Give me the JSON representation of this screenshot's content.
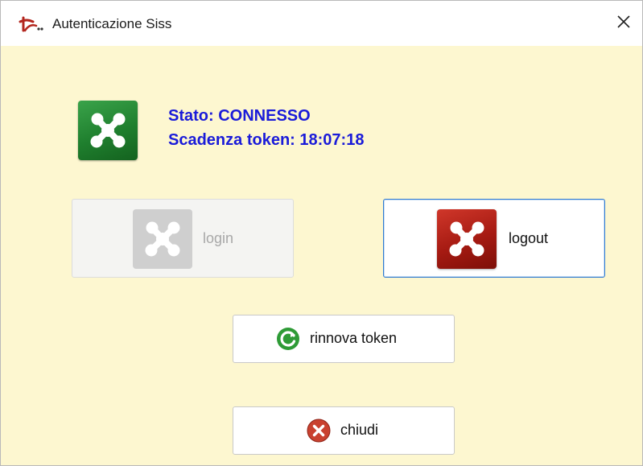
{
  "window": {
    "title": "Autenticazione Siss",
    "app_icon": "siss-logo-icon",
    "close_icon": "close-icon"
  },
  "status": {
    "icon": "network-connected-icon",
    "icon_color": "#2a8f3a",
    "state_line": "Stato: CONNESSO",
    "expiry_line": "Scadenza token: 18:07:18",
    "text_color": "#1a1bd9"
  },
  "buttons": {
    "login": {
      "label": "login",
      "enabled": false,
      "icon": "network-icon-disabled"
    },
    "logout": {
      "label": "logout",
      "enabled": true,
      "icon": "network-disconnect-icon",
      "icon_color": "#b02419"
    },
    "renew": {
      "label": "rinnova token",
      "icon": "refresh-icon",
      "icon_color": "#2e9b36"
    },
    "close": {
      "label": "chiudi",
      "icon": "close-circle-icon",
      "icon_color": "#c9412f"
    }
  },
  "colors": {
    "background": "#fdf7d0",
    "accent_border": "#2f7ad1"
  }
}
